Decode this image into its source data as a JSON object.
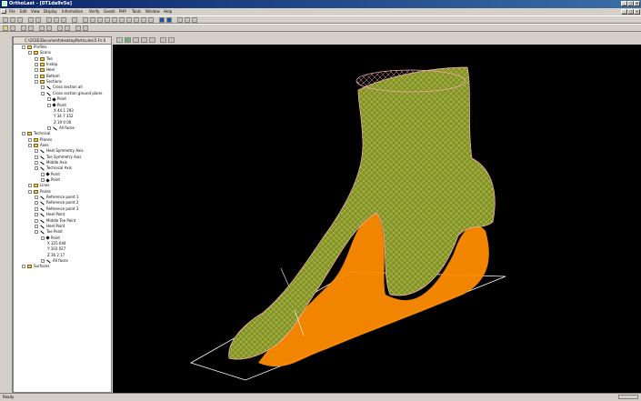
{
  "window": {
    "title": "OrthoLast - [0T1da9v5e]"
  },
  "menu": [
    "File",
    "Edit",
    "View",
    "Display",
    "Information",
    "Verify",
    "Goods",
    "PHP",
    "Tools",
    "Window",
    "Help"
  ],
  "tree": {
    "header": "C:\\OCEE\\Document\\desktopParticules\\5-Fn:0",
    "rows": [
      {
        "t": "Profiles",
        "i": 1,
        "k": "folder"
      },
      {
        "t": "Scans",
        "i": 2,
        "k": "folder"
      },
      {
        "t": "Toe",
        "i": 3,
        "k": "folder"
      },
      {
        "t": "Instep",
        "i": 3,
        "k": "folder"
      },
      {
        "t": "Heel",
        "i": 3,
        "k": "folder"
      },
      {
        "t": "Bottom",
        "i": 3,
        "k": "folder"
      },
      {
        "t": "Sections",
        "i": 3,
        "k": "folder"
      },
      {
        "t": "Cross section all",
        "i": 4,
        "k": "line"
      },
      {
        "t": "Cross section ground plane",
        "i": 4,
        "k": "line"
      },
      {
        "t": "Point",
        "i": 5,
        "k": "point"
      },
      {
        "t": "Point",
        "i": 5,
        "k": "point"
      },
      {
        "t": "X 44.1 293",
        "i": 6,
        "k": "text"
      },
      {
        "t": "Y 34 7 352",
        "i": 6,
        "k": "text"
      },
      {
        "t": "Z 19 0 00",
        "i": 6,
        "k": "text"
      },
      {
        "t": "All faces",
        "i": 5,
        "k": "line"
      },
      {
        "t": "Technical",
        "i": 1,
        "k": "folder"
      },
      {
        "t": "Planes",
        "i": 2,
        "k": "folder"
      },
      {
        "t": "Axes",
        "i": 2,
        "k": "folder"
      },
      {
        "t": "Heel Symmetry Axis",
        "i": 3,
        "k": "line"
      },
      {
        "t": "Toe Symmetry Axis",
        "i": 3,
        "k": "line"
      },
      {
        "t": "Middle Axis",
        "i": 3,
        "k": "line"
      },
      {
        "t": "Technical Axis",
        "i": 3,
        "k": "line"
      },
      {
        "t": "Point",
        "i": 4,
        "k": "point"
      },
      {
        "t": "Point",
        "i": 4,
        "k": "point"
      },
      {
        "t": "Lines",
        "i": 2,
        "k": "folder"
      },
      {
        "t": "Points",
        "i": 2,
        "k": "folder"
      },
      {
        "t": "Reference point 1",
        "i": 3,
        "k": "line"
      },
      {
        "t": "Reference point 2",
        "i": 3,
        "k": "line"
      },
      {
        "t": "Reference point 3",
        "i": 3,
        "k": "line"
      },
      {
        "t": "Heel Point",
        "i": 3,
        "k": "line"
      },
      {
        "t": "Middle Toe Point",
        "i": 3,
        "k": "line"
      },
      {
        "t": "Heel Point",
        "i": 3,
        "k": "line"
      },
      {
        "t": "Toe Point",
        "i": 3,
        "k": "line"
      },
      {
        "t": "Point",
        "i": 4,
        "k": "point"
      },
      {
        "t": "X 325 044",
        "i": 5,
        "k": "text"
      },
      {
        "t": "Y 103 027",
        "i": 5,
        "k": "text"
      },
      {
        "t": "Z 36 2 17",
        "i": 5,
        "k": "text"
      },
      {
        "t": "All faces",
        "i": 4,
        "k": "line"
      },
      {
        "t": "Surfaces",
        "i": 1,
        "k": "folder"
      }
    ]
  },
  "status": {
    "text": "Ready"
  },
  "colors": {
    "viewport": "#000000",
    "mesh": "#f2a8a8",
    "sole": "#ff8c00",
    "foot": "#7a9a1a"
  }
}
